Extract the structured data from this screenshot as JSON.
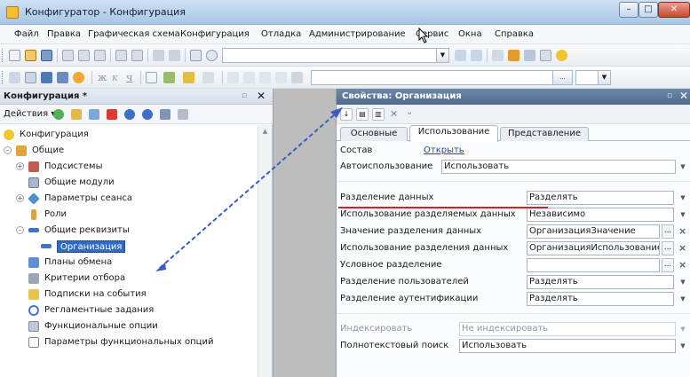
{
  "window": {
    "title": "Конфигуратор - Конфигурация",
    "buttons": {
      "minimize": "–",
      "maximize": "□",
      "close": "✕"
    }
  },
  "menu": [
    "Файл",
    "Правка",
    "Графическая схема",
    "Конфигурация",
    "Отладка",
    "Администрирование",
    "Сервис",
    "Окна",
    "Справка"
  ],
  "left_panel": {
    "title": "Конфигурация *",
    "actions_label": "Действия ▾",
    "tree": [
      {
        "label": "Конфигурация",
        "icon": "config-icon"
      },
      {
        "label": "Общие",
        "icon": "common-icon"
      },
      {
        "label": "Подсистемы",
        "icon": "subsystems-icon"
      },
      {
        "label": "Общие модули",
        "icon": "modules-icon"
      },
      {
        "label": "Параметры сеанса",
        "icon": "session-params-icon"
      },
      {
        "label": "Роли",
        "icon": "roles-icon"
      },
      {
        "label": "Общие реквизиты",
        "icon": "common-attributes-icon"
      },
      {
        "label": "Организация",
        "icon": "attribute-icon"
      },
      {
        "label": "Планы обмена",
        "icon": "exchange-plans-icon"
      },
      {
        "label": "Критерии отбора",
        "icon": "filter-criteria-icon"
      },
      {
        "label": "Подписки на события",
        "icon": "event-subscriptions-icon"
      },
      {
        "label": "Регламентные задания",
        "icon": "scheduled-jobs-icon"
      },
      {
        "label": "Функциональные опции",
        "icon": "functional-options-icon"
      },
      {
        "label": "Параметры функциональных опций",
        "icon": "functional-option-params-icon"
      }
    ]
  },
  "properties": {
    "title": "Свойства: Организация",
    "tabs": [
      "Основные",
      "Использование",
      "Представление"
    ],
    "rows": [
      {
        "label": "Состав",
        "link": "Открыть"
      },
      {
        "label": "Автоиспользование",
        "value": "Использовать"
      },
      {
        "label": "Разделение данных",
        "value": "Разделять"
      },
      {
        "label": "Использование разделяемых данных",
        "value": "Независимо"
      },
      {
        "label": "Значение разделения данных",
        "value": "ОрганизацияЗначение"
      },
      {
        "label": "Использование разделения данных",
        "value": "ОрганизацияИспользование"
      },
      {
        "label": "Условное разделение",
        "value": ""
      },
      {
        "label": "Разделение пользователей",
        "value": "Разделять"
      },
      {
        "label": "Разделение аутентификации",
        "value": "Разделять"
      },
      {
        "label": "Индексировать",
        "value": "Не индексировать"
      },
      {
        "label": "Полнотекстовый поиск",
        "value": "Использовать"
      }
    ]
  },
  "colors": {
    "selection": "#316ac5",
    "annotation_arrow": "#3a5cc7",
    "red_underline": "#c8252c",
    "properties_header": "#5d7797"
  }
}
